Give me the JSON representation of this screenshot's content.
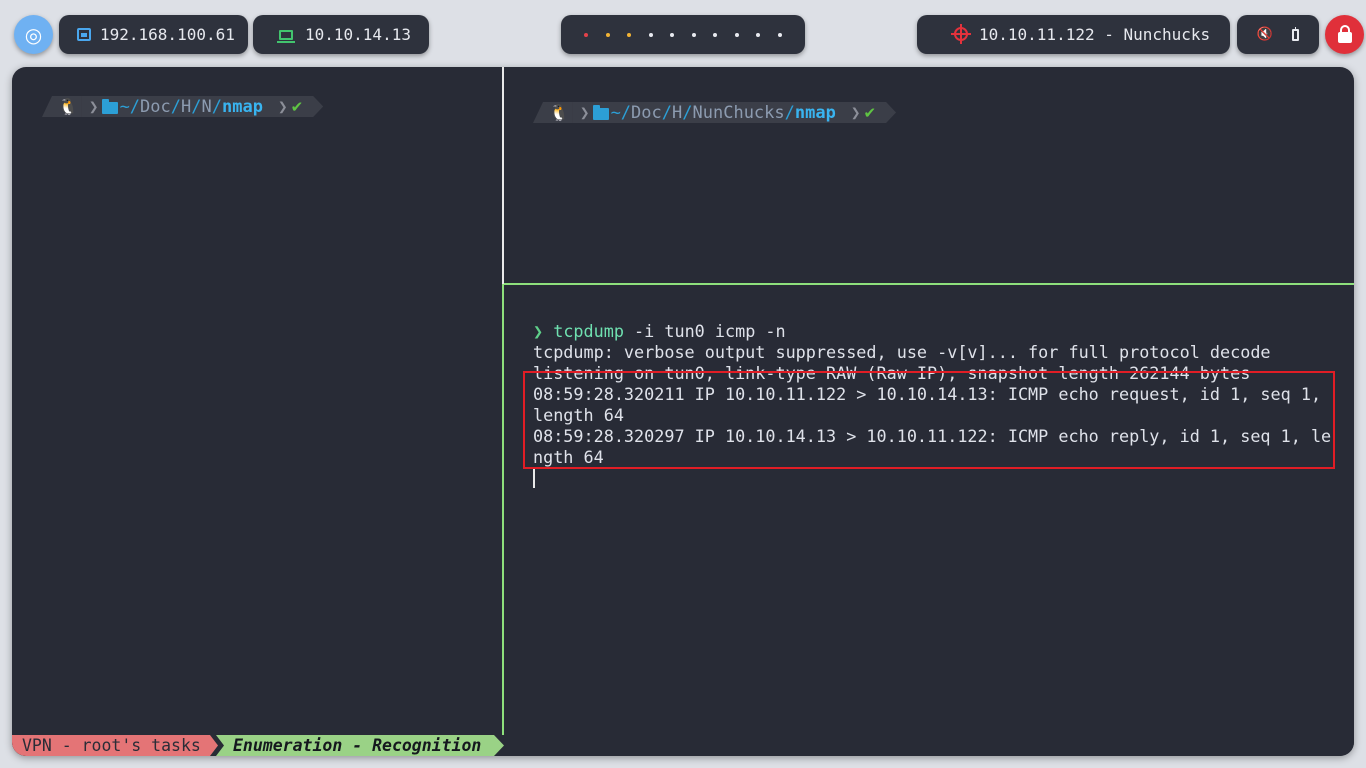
{
  "topbar": {
    "launcher_glyph": "◎",
    "host_ip": "192.168.100.61",
    "vpn_ip": "10.10.14.13",
    "target": "10.10.11.122 - Nunchucks",
    "workspaces": [
      "active-red",
      "yellow",
      "yellow",
      "empty",
      "empty",
      "empty",
      "empty",
      "empty",
      "empty",
      "empty"
    ],
    "icons": [
      "network-icon",
      "laptop-icon",
      "target-icon",
      "mute-icon",
      "battery-icon",
      "lock-icon"
    ],
    "colors": {
      "accent_blue": "#4aa7ee",
      "accent_green": "#42c46e",
      "accent_red": "#e4323c"
    }
  },
  "left_pane": {
    "prompt": {
      "os_icon": "🐧",
      "path_home": "~/",
      "path_parts": [
        "Doc",
        "/",
        "H",
        "/",
        "N",
        "/"
      ],
      "cwd": "nmap",
      "status": "✔"
    }
  },
  "right_top_pane": {
    "prompt": {
      "os_icon": "🐧",
      "path_home": "~/",
      "path_parts": [
        "Doc",
        "/",
        "H",
        "/",
        "NunChucks",
        "/"
      ],
      "cwd": "nmap",
      "status": "✔"
    }
  },
  "right_bottom_pane": {
    "command": {
      "arrow": "❯",
      "program": "tcpdump",
      "args": " -i tun0 icmp -n"
    },
    "output": [
      "tcpdump: verbose output suppressed, use -v[v]... for full protocol decode",
      "listening on tun0, link-type RAW (Raw IP), snapshot length 262144 bytes",
      "08:59:28.320211 IP 10.10.11.122 > 10.10.14.13: ICMP echo request, id 1, seq 1,",
      "length 64",
      "08:59:28.320297 IP 10.10.14.13 > 10.10.11.122: ICMP echo reply, id 1, seq 1, le",
      "ngth 64"
    ]
  },
  "statusbar": {
    "tab_vpn": "VPN - root's tasks",
    "tab_current": "Enumeration - Recognition"
  }
}
